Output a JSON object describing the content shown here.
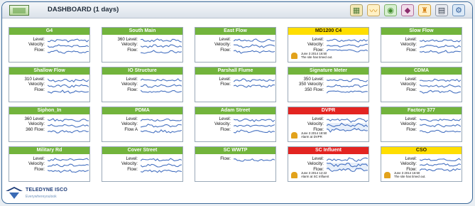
{
  "header": {
    "title": "DASHBOARD (1 days)"
  },
  "toolbar": {
    "icons": [
      "dashboard-icon",
      "graph-icon",
      "sites-icon",
      "alarm-icon",
      "bell-icon",
      "print-icon",
      "settings-icon"
    ]
  },
  "cards": [
    {
      "title": "G4",
      "color": "green",
      "labels": "Level:\nVelocity:\nFlow:"
    },
    {
      "title": "South Main",
      "color": "green",
      "labels": "360 Level:\nVelocity:\nFlow:"
    },
    {
      "title": "East Flow",
      "color": "green",
      "labels": "Level:\nVelocity:\nFlow:"
    },
    {
      "title": "MD1200 C4",
      "color": "yellow",
      "labels": "Level:\nVelocity:\nFlow:",
      "alarm_time": "June 3 2014 16:50",
      "alarm_msg": "The site has timed out."
    },
    {
      "title": "Slow Flow",
      "color": "green",
      "labels": "Level:\nVelocity:\nFlow:"
    },
    {
      "title": "Shallow Flow",
      "color": "green",
      "labels": "310 Level:\nVelocity:\nFlow:"
    },
    {
      "title": "IO Structure",
      "color": "green",
      "labels": "Level:\nVelocity:\nFlow:"
    },
    {
      "title": "Parshall Flume",
      "color": "green",
      "labels": "Level:\nFlow:"
    },
    {
      "title": "Signature Meter",
      "color": "green",
      "labels": "350 Level:\n350 Velocity:\n350 Flow:"
    },
    {
      "title": "CDMA",
      "color": "green",
      "labels": "Level:\nVelocity:\nFlow:"
    },
    {
      "title": "Siphon_In",
      "color": "green",
      "labels": "360 Level:\nVelocity:\n360 Flow:"
    },
    {
      "title": "PDMA",
      "color": "green",
      "labels": "Level:\nVelocity:\nFlow A"
    },
    {
      "title": "Adam Street",
      "color": "green",
      "labels": "Level:\nVelocity:\nFlow:"
    },
    {
      "title": "DVPR",
      "color": "red",
      "labels": "Level:\nVelocity:\nFlow:",
      "alarm_time": "June 3 2014 18:50",
      "alarm_msg": "Alarm at DVPR"
    },
    {
      "title": "Factory 377",
      "color": "green",
      "labels": "Level:\nVelocity:\nFlow:"
    },
    {
      "title": "Military Rd",
      "color": "green",
      "labels": "Level:\nVelocity:\nFlow:"
    },
    {
      "title": "Cover Street",
      "color": "green",
      "labels": "Level:\nVelocity:\nFlow:"
    },
    {
      "title": "SC WWTP",
      "color": "green",
      "labels": "Flow:"
    },
    {
      "title": "SC Influent",
      "color": "red",
      "labels": "Level:\nVelocity:\nFlow:",
      "alarm_time": "June 3 2014 12:22",
      "alarm_msg": "Alarm at SC Influent"
    },
    {
      "title": "CSO",
      "color": "yellow",
      "labels": "Level:\nVelocity:\nFlow:",
      "alarm_time": "June 3 2014 16:50",
      "alarm_msg": "The site has timed out."
    }
  ],
  "footer": {
    "brand": "TELEDYNE ISCO",
    "tagline": "Everywhereyoulook"
  },
  "colors": {
    "green": "#72b43c",
    "yellow": "#ffde00",
    "red": "#e32421",
    "trace": "#2d5fb8"
  }
}
